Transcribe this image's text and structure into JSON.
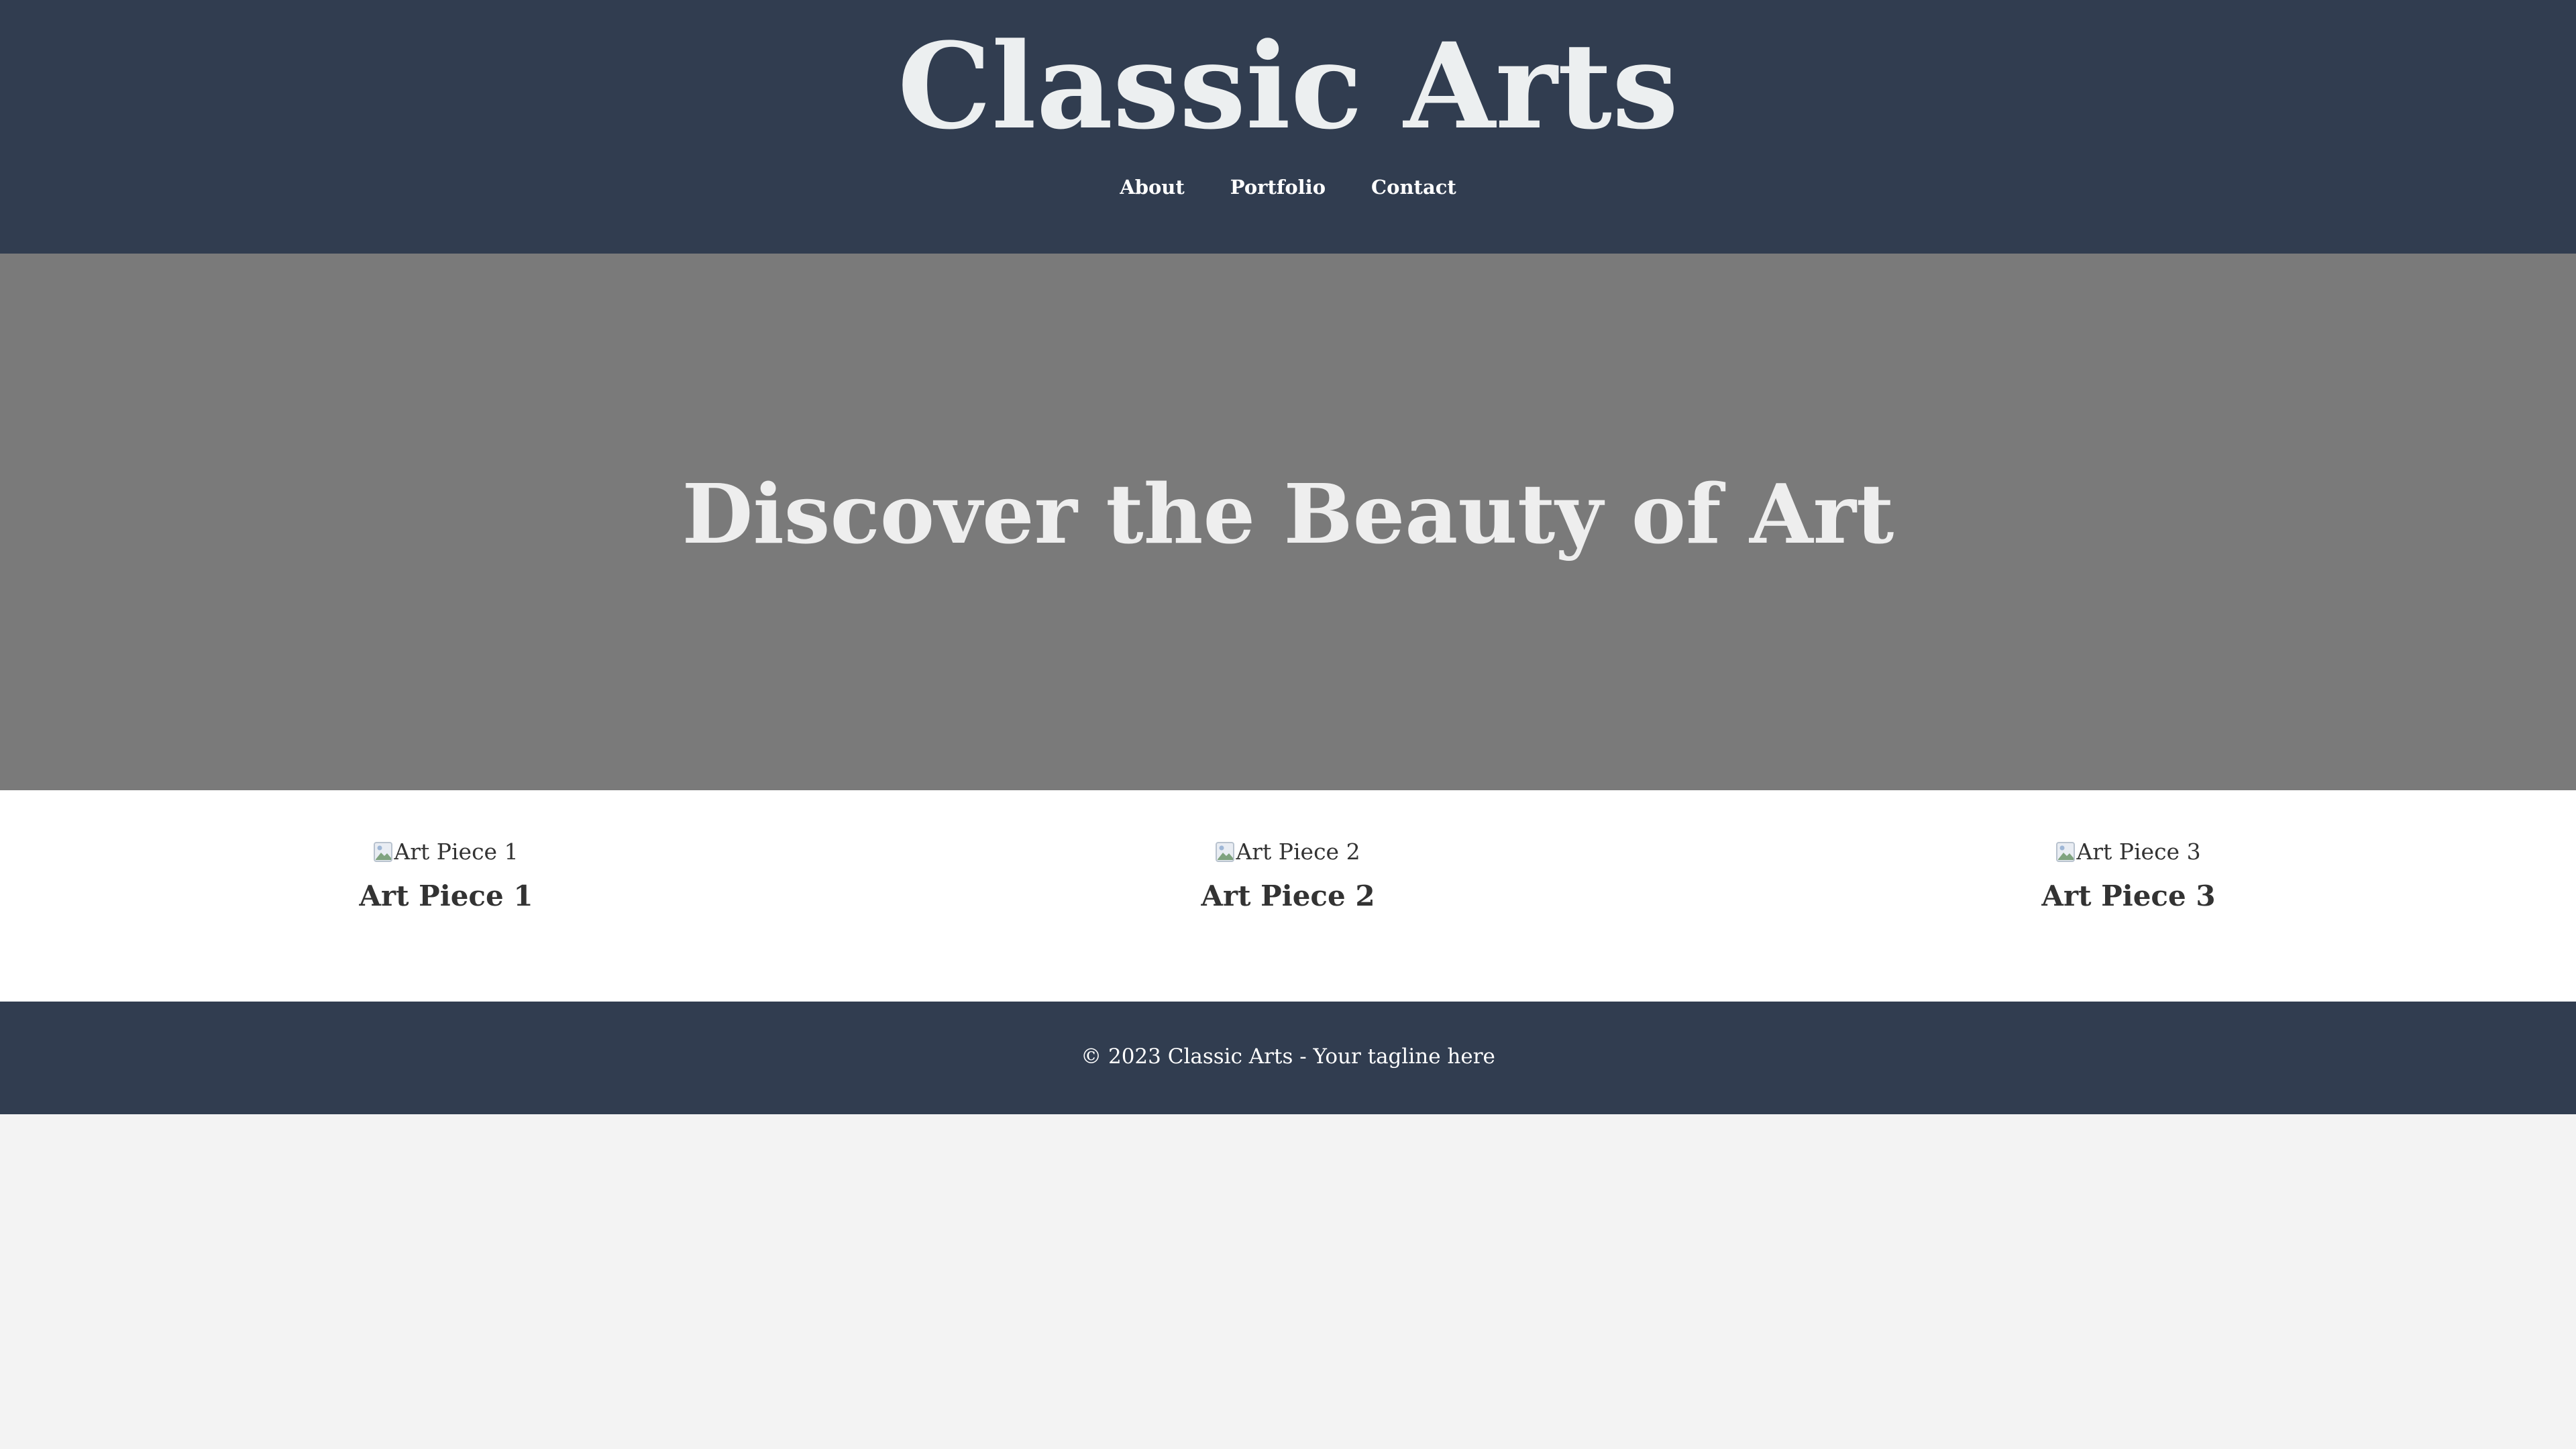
{
  "header": {
    "title": "Classic Arts",
    "nav": [
      {
        "label": "About"
      },
      {
        "label": "Portfolio"
      },
      {
        "label": "Contact"
      }
    ]
  },
  "hero": {
    "heading": "Discover the Beauty of Art"
  },
  "gallery": {
    "items": [
      {
        "alt": "Art Piece 1",
        "title": "Art Piece 1"
      },
      {
        "alt": "Art Piece 2",
        "title": "Art Piece 2"
      },
      {
        "alt": "Art Piece 3",
        "title": "Art Piece 3"
      }
    ]
  },
  "footer": {
    "text": "© 2023 Classic Arts - Your tagline here"
  },
  "colors": {
    "header_bg": "#313d50",
    "hero_bg": "#7a7a7a",
    "page_bg": "#f3f3f3",
    "text_light": "#eceff0",
    "text_dark": "#333333"
  },
  "icons": {
    "gallery_image": "broken-image-icon"
  }
}
